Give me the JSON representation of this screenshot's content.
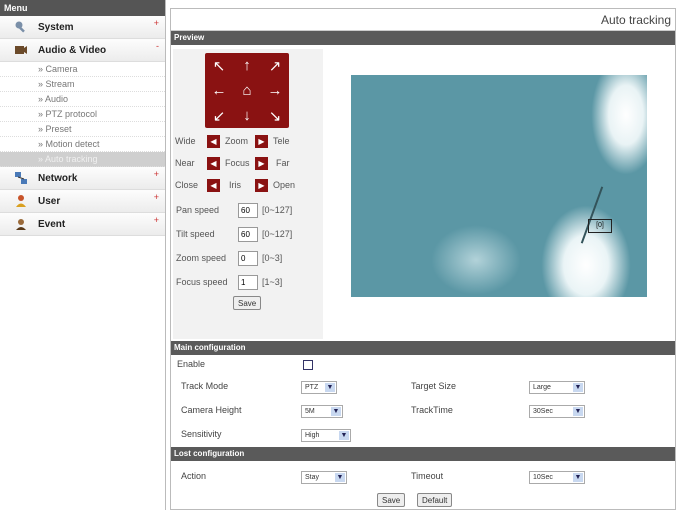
{
  "sidebar": {
    "title": "Menu",
    "categories": [
      {
        "label": "System",
        "icon": "wrench-icon"
      },
      {
        "label": "Audio & Video",
        "icon": "film-icon"
      },
      {
        "label": "Network",
        "icon": "network-icon"
      },
      {
        "label": "User",
        "icon": "user-icon"
      },
      {
        "label": "Event",
        "icon": "event-icon"
      }
    ],
    "expand_symbol": "+",
    "collapse_symbol": "-",
    "av_items": [
      "Camera",
      "Stream",
      "Audio",
      "PTZ protocol",
      "Preset",
      "Motion detect",
      "Auto tracking"
    ]
  },
  "page_title": "Auto tracking",
  "preview": {
    "section_title": "Preview",
    "arrows": {
      "ul": "↖",
      "up": "↑",
      "ur": "↗",
      "left": "←",
      "home": "⌂",
      "right": "→",
      "dl": "↙",
      "down": "↓",
      "dr": "↘"
    },
    "zoom": {
      "left": "Wide",
      "mid": "Zoom",
      "right": "Tele"
    },
    "focus": {
      "left": "Near",
      "mid": "Focus",
      "right": "Far"
    },
    "iris": {
      "left": "Close",
      "mid": "Iris",
      "right": "Open"
    },
    "speeds": [
      {
        "label": "Pan speed",
        "value": "60",
        "range": "[0~127]"
      },
      {
        "label": "Tilt speed",
        "value": "60",
        "range": "[0~127]"
      },
      {
        "label": "Zoom speed",
        "value": "0",
        "range": "[0~3]"
      },
      {
        "label": "Focus speed",
        "value": "1",
        "range": "[1~3]"
      }
    ],
    "save_label": "Save",
    "target_label": "[0]"
  },
  "main_config": {
    "section_title": "Main configuration",
    "enable_label": "Enable",
    "enable_checked": false,
    "track_mode_label": "Track Mode",
    "track_mode_value": "PTZ",
    "target_size_label": "Target Size",
    "target_size_value": "Large",
    "camera_height_label": "Camera Height",
    "camera_height_value": "5M",
    "track_time_label": "TrackTime",
    "track_time_value": "30Sec",
    "sensitivity_label": "Sensitivity",
    "sensitivity_value": "High"
  },
  "lost_config": {
    "section_title": "Lost configuration",
    "action_label": "Action",
    "action_value": "Stay",
    "timeout_label": "Timeout",
    "timeout_value": "10Sec"
  },
  "footer": {
    "save_label": "Save",
    "default_label": "Default"
  },
  "colors": {
    "accent_red": "#8a1212",
    "section_bar": "#5a5a5a",
    "video_bg": "#5b97a5"
  }
}
